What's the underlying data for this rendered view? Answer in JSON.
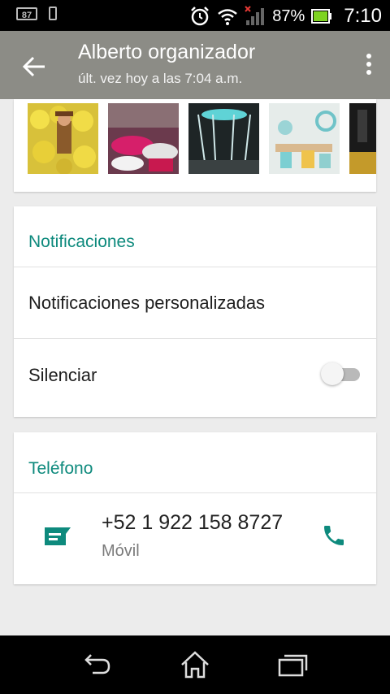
{
  "status_bar": {
    "battery_badge": "87",
    "battery_percent": "87%",
    "time": "7:10",
    "icons": [
      "battery-badge-icon",
      "phone-icon",
      "alarm-icon",
      "wifi-icon",
      "signal-icon",
      "battery-icon"
    ]
  },
  "header": {
    "title": "Alberto organizador",
    "subtitle": "últ. vez hoy a las 7:04 a.m.",
    "back_icon": "arrow-left-icon",
    "menu_icon": "more-vert-icon"
  },
  "media": {
    "thumbnails": [
      "media-thumb-1",
      "media-thumb-2",
      "media-thumb-3",
      "media-thumb-4",
      "media-thumb-5"
    ]
  },
  "notifications": {
    "section_title": "Notificaciones",
    "custom_label": "Notificaciones personalizadas",
    "mute_label": "Silenciar",
    "mute_on": false
  },
  "phone": {
    "section_title": "Teléfono",
    "number": "+52 1 922 158 8727",
    "type": "Móvil",
    "message_icon": "message-icon",
    "call_icon": "call-icon"
  },
  "nav_bar": {
    "icons": [
      "back-icon",
      "home-icon",
      "recents-icon"
    ]
  },
  "colors": {
    "accent": "#0e8a7d",
    "app_bar": "#8c8c86",
    "background": "#ececec"
  }
}
